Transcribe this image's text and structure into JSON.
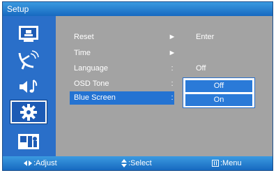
{
  "window": {
    "title": "Setup"
  },
  "sidebar": {
    "items": [
      {
        "name": "picture",
        "icon": "picture-icon"
      },
      {
        "name": "antenna",
        "icon": "satellite-dish-icon"
      },
      {
        "name": "sound",
        "icon": "speaker-music-icon"
      },
      {
        "name": "setup",
        "icon": "gear-icon",
        "selected": true
      },
      {
        "name": "parental",
        "icon": "person-lock-icon"
      }
    ]
  },
  "menu": {
    "rows": [
      {
        "label": "Reset",
        "sep": "►",
        "value": "Enter"
      },
      {
        "label": "Time",
        "sep": "►",
        "value": ""
      },
      {
        "label": "Language",
        "sep": ":",
        "value": "Off"
      },
      {
        "label": "OSD Tone",
        "sep": ":",
        "value": ""
      },
      {
        "label": "Blue Screen",
        "sep": ":",
        "value": "",
        "selected": true
      }
    ]
  },
  "dropdown": {
    "options": [
      "Off",
      "On"
    ]
  },
  "footer": {
    "adjust": ":Adjust",
    "select": ":Select",
    "menu": ":Menu"
  },
  "colors": {
    "bar_blue": "#1f76cf",
    "highlight_blue": "#2473d2",
    "panel_gray": "#a3a3a3"
  }
}
